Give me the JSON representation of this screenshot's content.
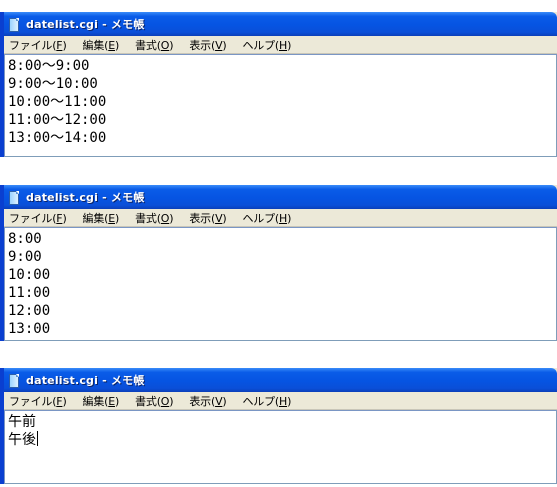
{
  "windows": [
    {
      "title": "datelist.cgi - メモ帳",
      "menu": [
        {
          "label": "ファイル",
          "accel": "F"
        },
        {
          "label": "編集",
          "accel": "E"
        },
        {
          "label": "書式",
          "accel": "O"
        },
        {
          "label": "表示",
          "accel": "V"
        },
        {
          "label": "ヘルプ",
          "accel": "H"
        }
      ],
      "lines": [
        "8:00～9:00",
        "9:00～10:00",
        "10:00～11:00",
        "11:00～12:00",
        "13:00～14:00"
      ]
    },
    {
      "title": "datelist.cgi - メモ帳",
      "menu": [
        {
          "label": "ファイル",
          "accel": "F"
        },
        {
          "label": "編集",
          "accel": "E"
        },
        {
          "label": "書式",
          "accel": "O"
        },
        {
          "label": "表示",
          "accel": "V"
        },
        {
          "label": "ヘルプ",
          "accel": "H"
        }
      ],
      "lines": [
        "8:00",
        "9:00",
        "10:00",
        "11:00",
        "12:00",
        "13:00"
      ]
    },
    {
      "title": "datelist.cgi - メモ帳",
      "menu": [
        {
          "label": "ファイル",
          "accel": "F"
        },
        {
          "label": "編集",
          "accel": "E"
        },
        {
          "label": "書式",
          "accel": "O"
        },
        {
          "label": "表示",
          "accel": "V"
        },
        {
          "label": "ヘルプ",
          "accel": "H"
        }
      ],
      "lines": [
        "午前",
        "午後"
      ]
    }
  ]
}
